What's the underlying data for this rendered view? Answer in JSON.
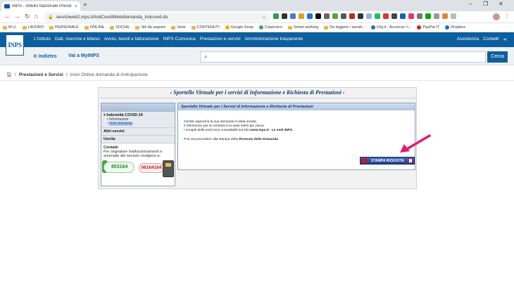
{
  "browser": {
    "tab_title": "INPS - Istituto Nazionale Previd...",
    "tab_close": "×",
    "new_tab": "+",
    "url": "serviziweb2.inps.it/IndCovidWeb/domanda_indcovid.do",
    "window_minimize": "–",
    "window_restore": "❐",
    "window_close": "✕",
    "bookmarks": [
      "M.U.",
      "LAVORO",
      "PERSONALE",
      "ONLINE",
      "SOCIAL",
      "Siti da seguire",
      "Varie",
      "CONTENUTI",
      "Google Keep",
      "Copernico",
      "Smart working",
      "Da leggere / ascolt...",
      "Urly.it - Accorcia i t...",
      "PayPal IT",
      "Dropbox"
    ]
  },
  "inps": {
    "logo": "INPS",
    "topnav": [
      "L'Istituto",
      "Dati, ricerche e bilanci",
      "Avvisi, bandi e fatturazione",
      "INPS Comunica",
      "Prestazioni e servizi",
      "Amministrazione trasparente"
    ],
    "topright": [
      "Assistenza",
      "Contatti"
    ],
    "indietro": "⊖ Indietro",
    "vai_myinps": "Vai a MyINPS",
    "search_placeholder": "",
    "cerca": "Cerca",
    "breadcrumb": {
      "home": "🏠",
      "sep": "/",
      "level1": "Prestazioni e Servizi",
      "level2": "Invio Online domanda di Anticipazione"
    }
  },
  "portal": {
    "title": "‹  Sportello Virtuale per i servizi di Informazione e Richiesta di Prestazioni  ›",
    "sidebar": {
      "header": "Servizi Online",
      "section_title": "▾ Indennità COVID-19",
      "sub_items": [
        "Informazioni",
        "Invio domanda"
      ],
      "altri_servizi": "Altri servizi",
      "uscita": "Uscita",
      "contatti_title": "Contatti",
      "contatti_text": "Per segnalare malfunzionamenti e anomalie del servizio rivolgersi a:",
      "phone_green": "803164",
      "phone_red": "06164164"
    },
    "content": {
      "header": "Sportello Virtuale per i Servizi di Informazione e Richiesta di Prestazioni",
      "line1": "Gentile signore/a la sua domanda è stata inviata.",
      "line2": "Il riferimento per la richiesta è la sede INPS più vicina.",
      "line3_prefix": "I recapiti delle sedi sono consultabili sul sito ",
      "line3_site": "www.inps.it",
      "line3_suffix": " - Le sedi INPS.",
      "line4_prefix": "Può ora procedere alla stampa della ",
      "line4_bold": "Ricevuta della Domanda",
      "line4_suffix": ".",
      "button": "STAMPA RICEVUTA"
    }
  }
}
